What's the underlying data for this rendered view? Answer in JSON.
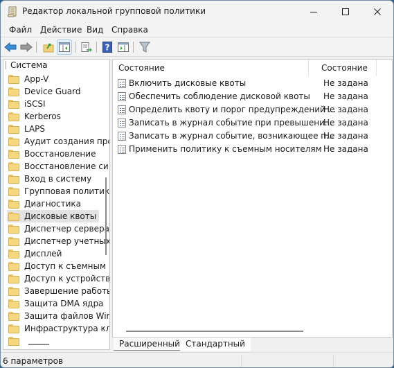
{
  "window": {
    "title": "Редактор локальной групповой политики",
    "app_icon": "scroll-icon",
    "controls": {
      "minimize": "minimize-icon",
      "maximize": "maximize-icon",
      "close": "close-icon"
    }
  },
  "menubar": {
    "items": [
      {
        "label": "Файл"
      },
      {
        "label": "Действие"
      },
      {
        "label": "Вид"
      },
      {
        "label": "Справка"
      }
    ]
  },
  "toolbar": {
    "buttons": [
      {
        "icon": "back-arrow-icon",
        "active": false
      },
      {
        "icon": "forward-arrow-icon",
        "active": false
      },
      {
        "icon": "up-folder-icon",
        "active": false
      },
      {
        "icon": "show-hide-tree-icon",
        "active": true
      },
      {
        "icon": "export-list-icon",
        "active": false
      },
      {
        "icon": "help-icon",
        "active": false
      },
      {
        "icon": "show-hide-action-pane-icon",
        "active": false
      },
      {
        "icon": "filter-icon",
        "active": false
      }
    ]
  },
  "tree": {
    "root": "Система",
    "items": [
      {
        "label": "App-V",
        "selected": false
      },
      {
        "label": "Device Guard",
        "selected": false
      },
      {
        "label": "iSCSI",
        "selected": false
      },
      {
        "label": "Kerberos",
        "selected": false
      },
      {
        "label": "LAPS",
        "selected": false
      },
      {
        "label": "Аудит создания прс",
        "selected": false
      },
      {
        "label": "Восстановление",
        "selected": false
      },
      {
        "label": "Восстановление си",
        "selected": false
      },
      {
        "label": "Вход в систему",
        "selected": false
      },
      {
        "label": "Групповая политик",
        "selected": false
      },
      {
        "label": "Диагностика",
        "selected": false
      },
      {
        "label": "Дисковые квоты",
        "selected": true
      },
      {
        "label": "Диспетчер сервера",
        "selected": false
      },
      {
        "label": "Диспетчер учетных",
        "selected": false
      },
      {
        "label": "Дисплей",
        "selected": false
      },
      {
        "label": "Доступ к съемным",
        "selected": false
      },
      {
        "label": "Доступ к устройств",
        "selected": false
      },
      {
        "label": "Завершение работь",
        "selected": false
      },
      {
        "label": "Защита DMA ядра",
        "selected": false
      },
      {
        "label": "Защита файлов Wir",
        "selected": false
      },
      {
        "label": "Инфраструктура кл",
        "selected": false
      }
    ]
  },
  "list": {
    "columns": [
      {
        "label": "Состояние"
      },
      {
        "label": "Состояние"
      }
    ],
    "rows": [
      {
        "name": "Включить дисковые квоты",
        "state": "Не задана"
      },
      {
        "name": "Обеспечить соблюдение дисковой квоты",
        "state": "Не задана"
      },
      {
        "name": "Определить квоту и порог предупреждений ...",
        "state": "Не задана"
      },
      {
        "name": "Записать в журнал событие при превышени...",
        "state": "Не задана"
      },
      {
        "name": "Записать в журнал событие, возникающее п...",
        "state": "Не задана"
      },
      {
        "name": "Применить политику к съемным носителям",
        "state": "Не задана"
      }
    ]
  },
  "view_tabs": [
    {
      "label": "Расширенный",
      "active": false
    },
    {
      "label": "Стандартный",
      "active": true
    }
  ],
  "statusbar": {
    "text": "6 параметров"
  }
}
